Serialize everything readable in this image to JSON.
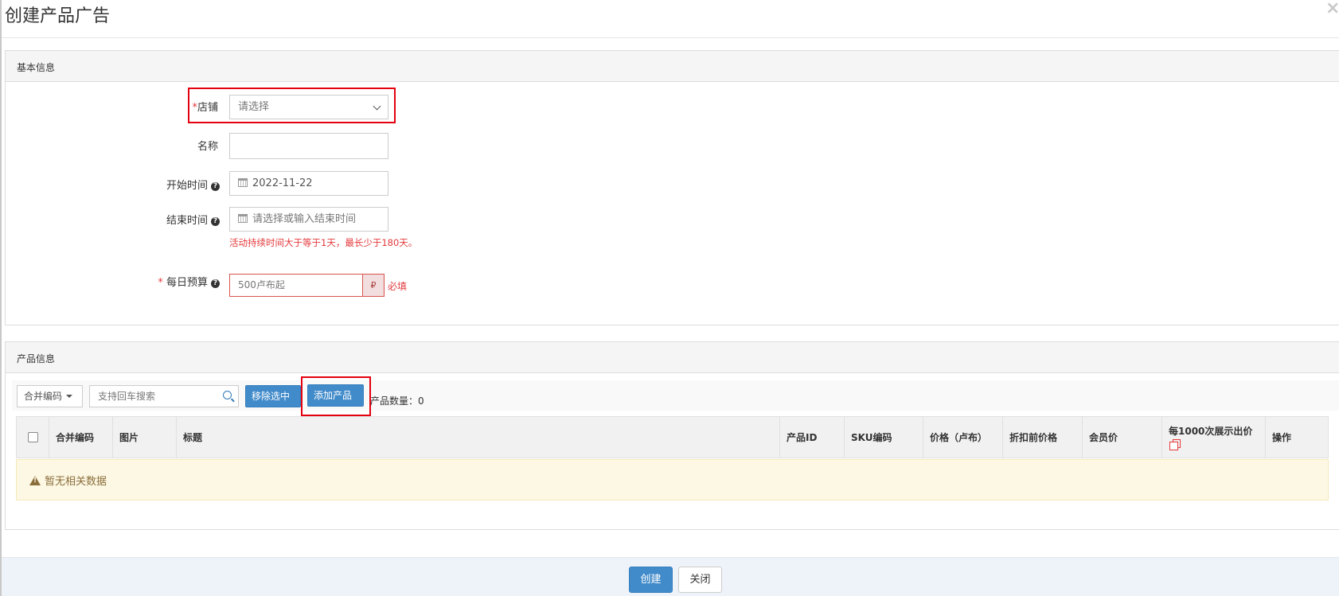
{
  "dialog": {
    "title": "创建产品广告",
    "close_label": "×"
  },
  "basic_section": {
    "title": "基本信息",
    "store": {
      "required_mark": "*",
      "label": "店铺",
      "placeholder": "请选择"
    },
    "name": {
      "label": "名称",
      "value": ""
    },
    "start_time": {
      "label": "开始时间",
      "value": "2022-11-22"
    },
    "end_time": {
      "label": "结束时间",
      "placeholder": "请选择或输入结束时间",
      "hint": "活动持续时间大于等于1天，最长少于180天。"
    },
    "daily_budget": {
      "required_mark": "*",
      "label": "每日预算",
      "placeholder": "500卢布起",
      "currency_symbol": "₽",
      "required_text": "必填"
    }
  },
  "product_section": {
    "title": "产品信息",
    "toolbar": {
      "code_dropdown": "合并编码",
      "search_placeholder": "支持回车搜索",
      "remove_button": "移除选中",
      "add_button": "添加产品",
      "count_label": "产品数量：",
      "count_value": "0"
    },
    "table": {
      "columns": [
        "合并编码",
        "图片",
        "标题",
        "产品ID",
        "SKU编码",
        "价格（卢布）",
        "折扣前价格",
        "会员价",
        "每1000次展示出价",
        "操作"
      ],
      "empty_message": "暂无相关数据"
    }
  },
  "footer": {
    "create_button": "创建",
    "close_button": "关闭"
  },
  "colors": {
    "primary": "#428bca",
    "error": "#e4393c",
    "highlight_box": "#e4000f",
    "warning_bg": "#fcf8e3"
  }
}
